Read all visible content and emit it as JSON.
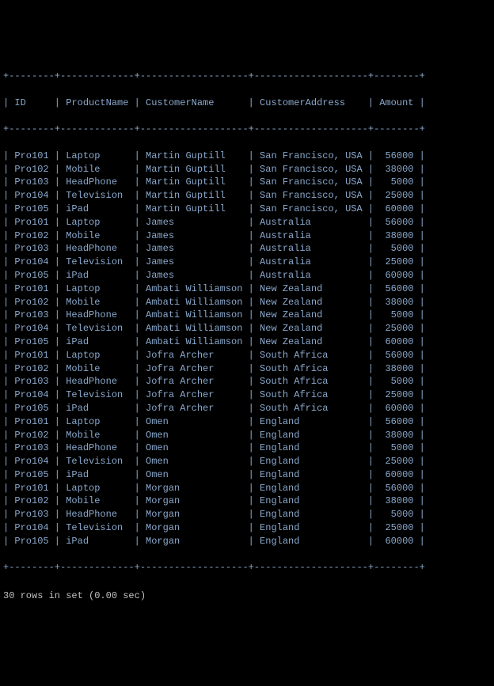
{
  "border_top": "+--------+-------------+-------------------+--------------------+--------+",
  "header": "| ID     | ProductName | CustomerName      | CustomerAddress    | Amount |",
  "border_mid": "+--------+-------------+-------------------+--------------------+--------+",
  "rows": [
    "| Pro101 | Laptop      | Martin Guptill    | San Francisco, USA |  56000 |",
    "| Pro102 | Mobile      | Martin Guptill    | San Francisco, USA |  38000 |",
    "| Pro103 | HeadPhone   | Martin Guptill    | San Francisco, USA |   5000 |",
    "| Pro104 | Television  | Martin Guptill    | San Francisco, USA |  25000 |",
    "| Pro105 | iPad        | Martin Guptill    | San Francisco, USA |  60000 |",
    "| Pro101 | Laptop      | James             | Australia          |  56000 |",
    "| Pro102 | Mobile      | James             | Australia          |  38000 |",
    "| Pro103 | HeadPhone   | James             | Australia          |   5000 |",
    "| Pro104 | Television  | James             | Australia          |  25000 |",
    "| Pro105 | iPad        | James             | Australia          |  60000 |",
    "| Pro101 | Laptop      | Ambati Williamson | New Zealand        |  56000 |",
    "| Pro102 | Mobile      | Ambati Williamson | New Zealand        |  38000 |",
    "| Pro103 | HeadPhone   | Ambati Williamson | New Zealand        |   5000 |",
    "| Pro104 | Television  | Ambati Williamson | New Zealand        |  25000 |",
    "| Pro105 | iPad        | Ambati Williamson | New Zealand        |  60000 |",
    "| Pro101 | Laptop      | Jofra Archer      | South Africa       |  56000 |",
    "| Pro102 | Mobile      | Jofra Archer      | South Africa       |  38000 |",
    "| Pro103 | HeadPhone   | Jofra Archer      | South Africa       |   5000 |",
    "| Pro104 | Television  | Jofra Archer      | South Africa       |  25000 |",
    "| Pro105 | iPad        | Jofra Archer      | South Africa       |  60000 |",
    "| Pro101 | Laptop      | Omen              | England            |  56000 |",
    "| Pro102 | Mobile      | Omen              | England            |  38000 |",
    "| Pro103 | HeadPhone   | Omen              | England            |   5000 |",
    "| Pro104 | Television  | Omen              | England            |  25000 |",
    "| Pro105 | iPad        | Omen              | England            |  60000 |",
    "| Pro101 | Laptop      | Morgan            | England            |  56000 |",
    "| Pro102 | Mobile      | Morgan            | England            |  38000 |",
    "| Pro103 | HeadPhone   | Morgan            | England            |   5000 |",
    "| Pro104 | Television  | Morgan            | England            |  25000 |",
    "| Pro105 | iPad        | Morgan            | England            |  60000 |"
  ],
  "border_bot": "+--------+-------------+-------------------+--------------------+--------+",
  "status": "30 rows in set (0.00 sec)"
}
